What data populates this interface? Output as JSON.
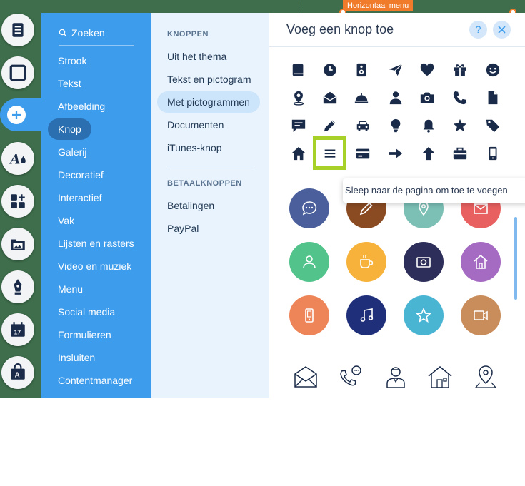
{
  "canvas": {
    "horizontal_menu_tag": "Horizontaal menu"
  },
  "rail": {
    "buttons": [
      {
        "icon": "pages-icon"
      },
      {
        "icon": "background-icon"
      },
      {
        "icon": "add-icon",
        "active": true
      },
      {
        "icon": "theme-icon"
      },
      {
        "icon": "apps-icon"
      },
      {
        "icon": "media-icon"
      },
      {
        "icon": "blog-icon"
      },
      {
        "icon": "bookings-icon"
      },
      {
        "icon": "store-icon"
      }
    ]
  },
  "categories": {
    "search_label": "Zoeken",
    "items": [
      "Strook",
      "Tekst",
      "Afbeelding",
      "Knop",
      "Galerij",
      "Decoratief",
      "Interactief",
      "Vak",
      "Lijsten en rasters",
      "Video en muziek",
      "Menu",
      "Social media",
      "Formulieren",
      "Insluiten",
      "Contentmanager"
    ],
    "active": "Knop"
  },
  "subpanel": {
    "section1_title": "KNOPPEN",
    "items1": [
      "Uit het thema",
      "Tekst en pictogram",
      "Met pictogrammen",
      "Documenten",
      "iTunes-knop"
    ],
    "section2_title": "BETAALKNOPPEN",
    "items2": [
      "Betalingen",
      "PayPal"
    ],
    "active": "Met pictogrammen"
  },
  "main": {
    "title": "Voeg een knop toe",
    "help_label": "?",
    "glyph_icons": [
      "book-icon",
      "clock-icon",
      "speaker-icon",
      "send-icon",
      "heart-icon",
      "gift-icon",
      "smile-icon",
      "location-icon",
      "envelope-icon",
      "service-bell-icon",
      "user-icon",
      "camera-icon",
      "phone-icon",
      "document-icon",
      "chat-icon",
      "pencil-icon",
      "car-icon",
      "lightbulb-icon",
      "bell-icon",
      "star-icon",
      "tag-icon",
      "home-icon",
      "menu-icon",
      "credit-card-icon",
      "arrow-right-icon",
      "arrow-up-icon",
      "briefcase-icon",
      "mobile-icon"
    ],
    "selected_glyph": "menu-icon",
    "circle_buttons": [
      {
        "icon": "chat-icon",
        "color": "#4a5f9c"
      },
      {
        "icon": "pencil-icon",
        "color": "#8a4b22"
      },
      {
        "icon": "location-icon",
        "color": "#7bbfb5"
      },
      {
        "icon": "envelope-icon",
        "color": "#e8605f"
      },
      {
        "icon": "user-icon",
        "color": "#51c38b"
      },
      {
        "icon": "coffee-icon",
        "color": "#f6b23a"
      },
      {
        "icon": "camera-icon",
        "color": "#2d2e59"
      },
      {
        "icon": "home-icon",
        "color": "#a56bc2"
      },
      {
        "icon": "mobile-icon",
        "color": "#ee8559"
      },
      {
        "icon": "music-icon",
        "color": "#1f2f7a"
      },
      {
        "icon": "star-icon",
        "color": "#4ab5d3"
      },
      {
        "icon": "video-icon",
        "color": "#c98d5b"
      }
    ],
    "outline_icons": [
      "envelope-outline-icon",
      "phone-chat-outline-icon",
      "person-outline-icon",
      "house-outline-icon",
      "location-outline-icon"
    ]
  },
  "tooltip": {
    "text": "Sleep naar de pagina om toe te voegen"
  },
  "colors": {
    "accent": "#3d9cec",
    "highlight": "#a7d129",
    "icon": "#1a2b49",
    "canvas": "#3e6e4c",
    "tag": "#f07b2b"
  }
}
